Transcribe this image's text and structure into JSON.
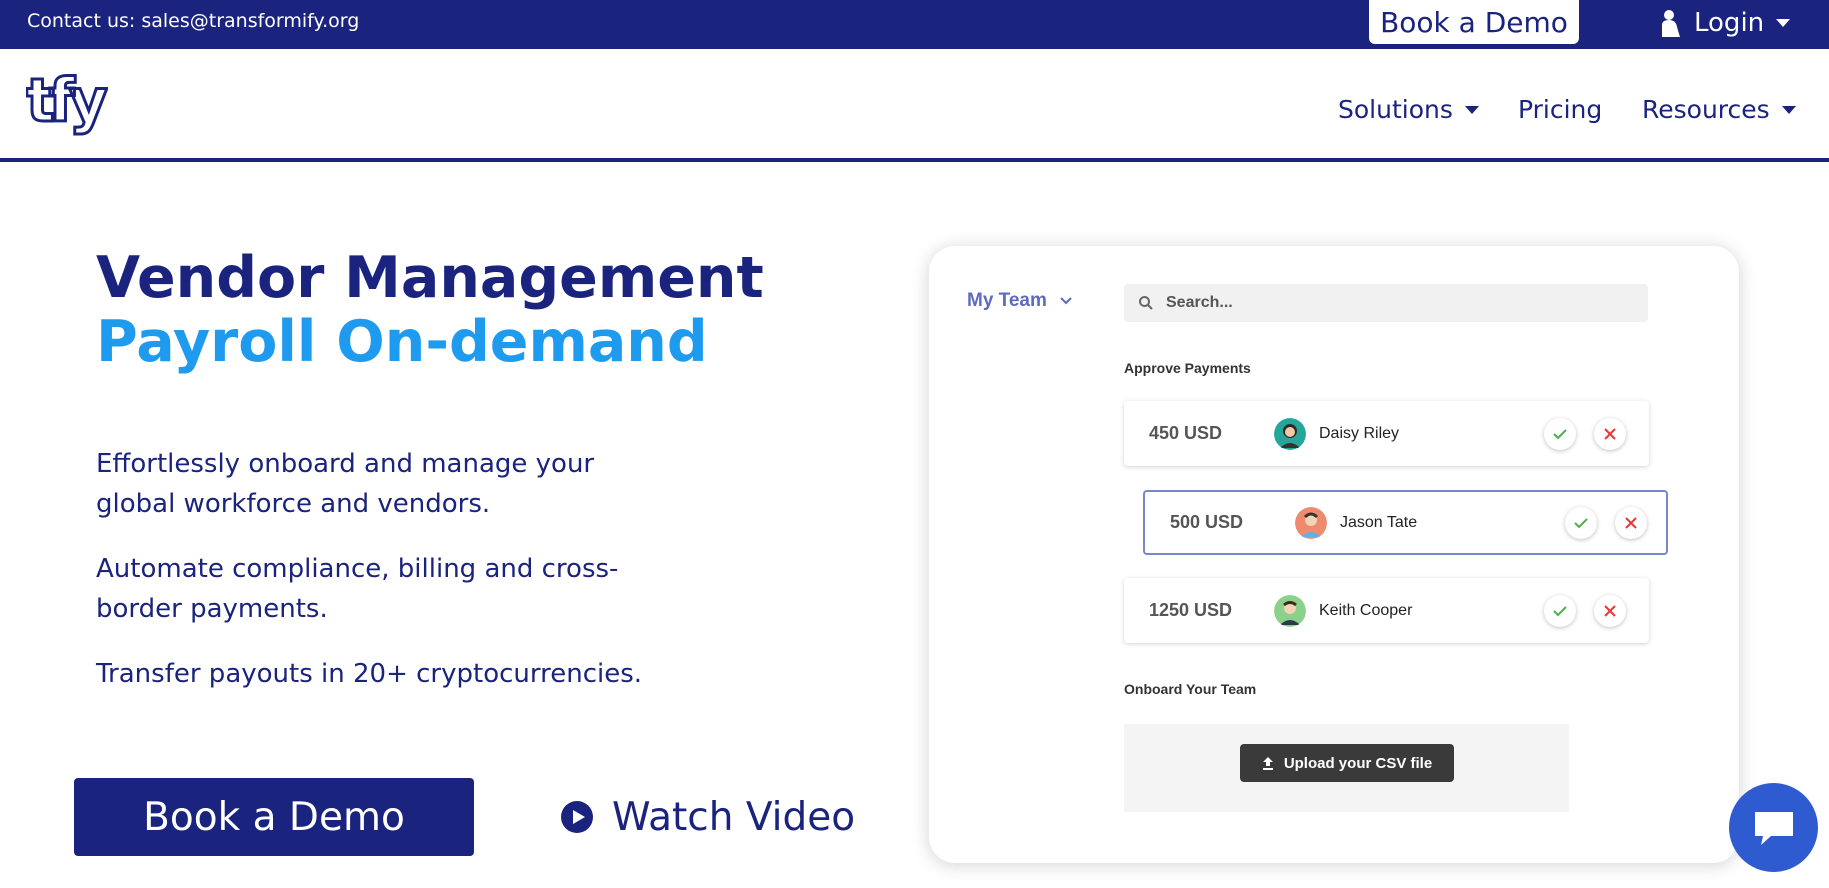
{
  "topbar": {
    "contact": "Contact us: sales@transformify.org",
    "book_demo": "Book a Demo",
    "login": "Login"
  },
  "nav": {
    "logo": "tfy",
    "items": [
      {
        "label": "Solutions",
        "icon": "caret-down-icon"
      },
      {
        "label": "Pricing"
      },
      {
        "label": "Resources",
        "icon": "caret-down-icon"
      }
    ]
  },
  "hero": {
    "title": "Vendor Management",
    "subtitle": "Payroll On-demand",
    "paragraphs": [
      "Effortlessly onboard and manage your global workforce and vendors.",
      "Automate compliance, billing and cross-border payments.",
      "Transfer payouts in 20+ cryptocurrencies."
    ],
    "cta_demo": "Book a Demo",
    "cta_video": "Watch Video"
  },
  "mock": {
    "team_selector": "My Team",
    "search_placeholder": "Search...",
    "approve_label": "Approve Payments",
    "payments": [
      {
        "amount": "450 USD",
        "name": "Daisy Riley"
      },
      {
        "amount": "500 USD",
        "name": "Jason Tate"
      },
      {
        "amount": "1250 USD",
        "name": "Keith Cooper"
      }
    ],
    "onboard_label": "Onboard Your Team",
    "upload_label": "Upload your CSV file"
  },
  "colors": {
    "navy": "#1a237e",
    "accent_blue": "#1e9bef",
    "chat_blue": "#2f5bd1",
    "approve_green": "#4caf50",
    "reject_red": "#e53935"
  }
}
